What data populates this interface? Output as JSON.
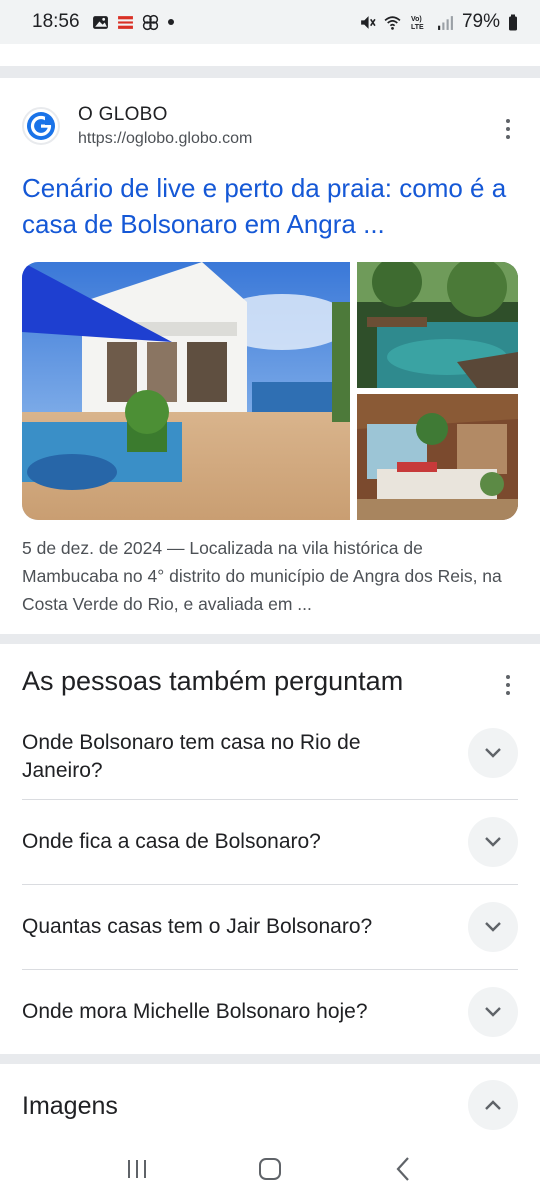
{
  "status_bar": {
    "time": "18:56",
    "battery": "79%",
    "icons_left": [
      "image-icon",
      "news-app-icon",
      "pinwheel-icon",
      "dot-icon"
    ],
    "icons_right": [
      "mute-icon",
      "wifi-icon",
      "volte-icon",
      "signal-icon",
      "battery-icon"
    ]
  },
  "result": {
    "site_name": "O GLOBO",
    "site_url": "https://oglobo.globo.com",
    "title": "Cenário de live e perto da praia: como é a casa de Bolsonaro em Angra ...",
    "snippet": "5 de dez. de 2024 — Localizada na vila histórica de Mambucaba no 4° distrito do município de Angra dos Reis, na Costa Verde do Rio, e avaliada em ...",
    "colors": {
      "title": "#1558d6",
      "favicon": "#1a73e8"
    }
  },
  "paa": {
    "title": "As pessoas também perguntam",
    "questions": [
      "Onde Bolsonaro tem casa no Rio de Janeiro?",
      "Onde fica a casa de Bolsonaro?",
      "Quantas casas tem o Jair Bolsonaro?",
      "Onde mora Michelle Bolsonaro hoje?"
    ]
  },
  "imagens": {
    "title": "Imagens"
  },
  "nav": [
    "recent-apps-icon",
    "home-icon",
    "back-icon"
  ]
}
